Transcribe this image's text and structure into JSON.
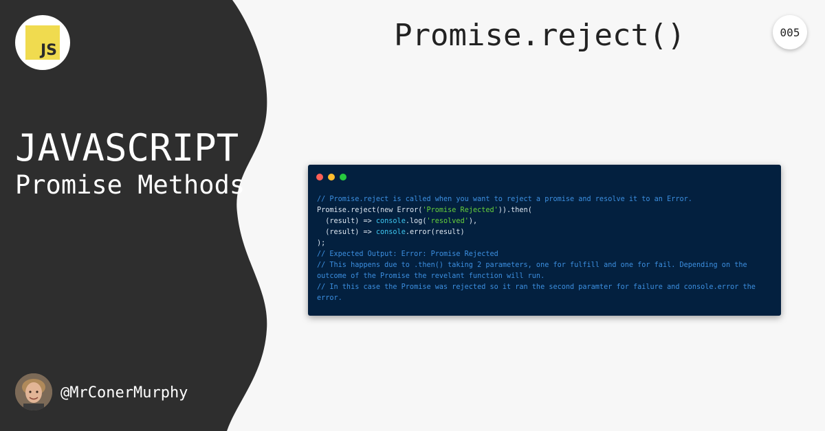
{
  "colors": {
    "sidebar_bg": "#2e2e2e",
    "page_bg": "#f7f7f7",
    "js_yellow": "#f0db4f",
    "code_bg": "#03203f",
    "comment": "#3c8fe0",
    "string": "#67d13b",
    "traffic_red": "#ff5f56",
    "traffic_yellow": "#ffbd2e",
    "traffic_green": "#27c93f"
  },
  "sidebar": {
    "logo_text": "JS",
    "title": "JAVASCRIPT",
    "subtitle": "Promise Methods",
    "author_handle": "@MrConerMurphy"
  },
  "header": {
    "title": "Promise.reject()",
    "number": "005"
  },
  "code": {
    "l1_comment": "// Promise.reject is called when you want to reject a promise and resolve it to an Error.",
    "l2_a": "Promise.reject(",
    "l2_new": "new",
    "l2_b": " Error(",
    "l2_str": "'Promise Rejected'",
    "l2_c": ")).then(",
    "l3_a": "  (result) => ",
    "l3_fn": "console",
    "l3_b": ".log(",
    "l3_str": "'resolved'",
    "l3_c": "),",
    "l4_a": "  (result) => ",
    "l4_fn": "console",
    "l4_b": ".error(result)",
    "l5": ");",
    "l6_comment": "// Expected Output: Error: Promise Rejected",
    "l7_comment": "// This happens due to .then() taking 2 parameters, one for fulfill and one for fail. Depending on the outcome of the Promise the revelant function will run.",
    "l8_comment": "// In this case the Promise was rejected so it ran the second paramter for failure and console.error the error."
  }
}
